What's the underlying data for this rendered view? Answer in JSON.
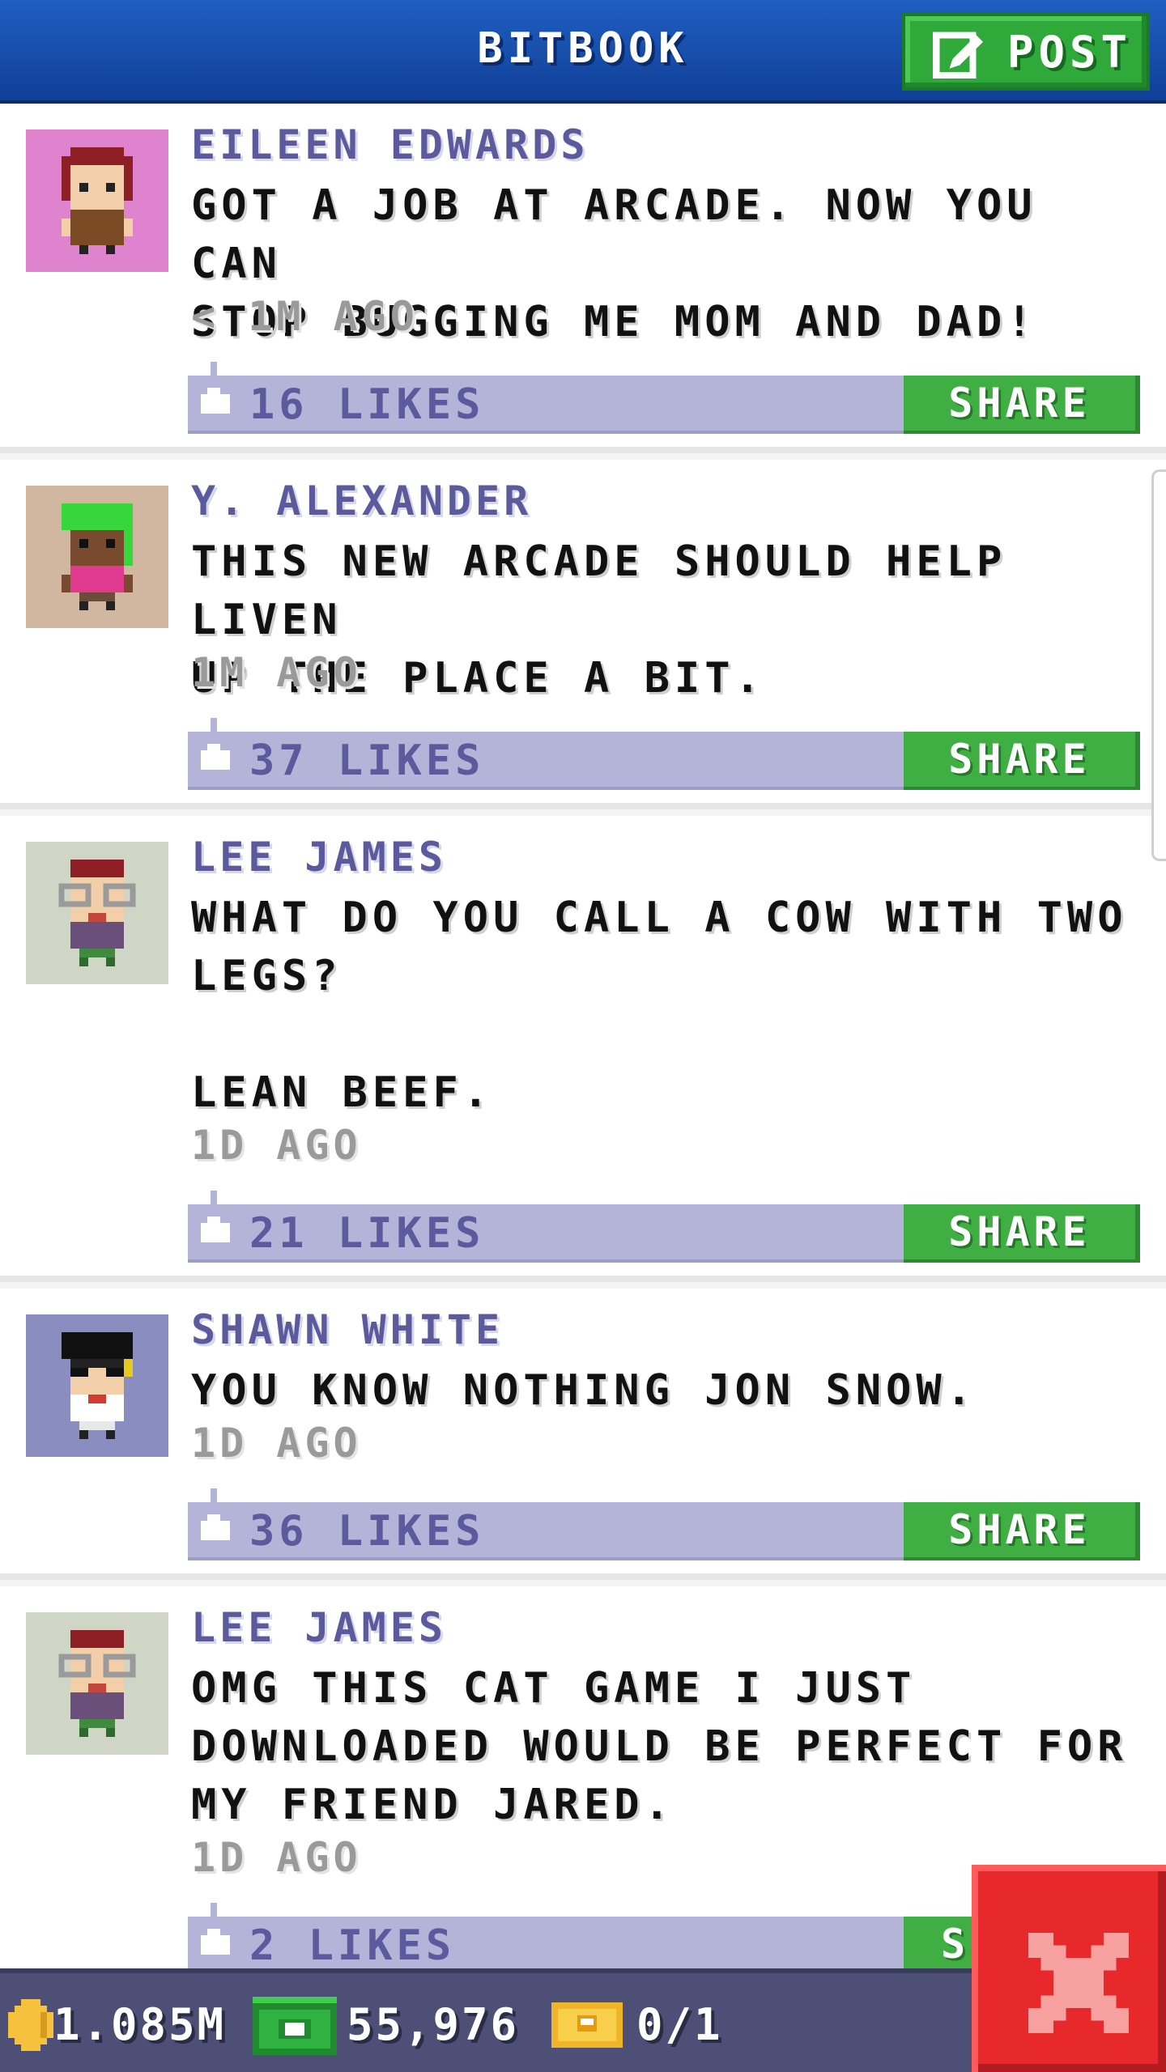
{
  "header": {
    "title": "BITBOOK",
    "post_label": "POST"
  },
  "posts": [
    {
      "author": "EILEEN EDWARDS",
      "message": "GOT A JOB AT ARCADE. NOW YOU CAN\nSTOP BUGGING ME MOM AND DAD!",
      "time": "< 1M AGO",
      "likes": "16 LIKES",
      "share": "SHARE",
      "avatar_bg": "#df83cf"
    },
    {
      "author": "Y. ALEXANDER",
      "message": "THIS NEW ARCADE SHOULD HELP LIVEN\nUP THE PLACE A BIT.",
      "time": "1M AGO",
      "likes": "37 LIKES",
      "share": "SHARE",
      "avatar_bg": "#d1b6a0"
    },
    {
      "author": "LEE JAMES",
      "message": "WHAT DO YOU CALL A COW WITH TWO\nLEGS?\n\nLEAN BEEF.",
      "time": "1D AGO",
      "likes": "21 LIKES",
      "share": "SHARE",
      "avatar_bg": "#cfd6c6"
    },
    {
      "author": "SHAWN WHITE",
      "message": "YOU KNOW NOTHING JON SNOW.",
      "time": "1D AGO",
      "likes": "36 LIKES",
      "share": "SHARE",
      "avatar_bg": "#8a8dc0"
    },
    {
      "author": "LEE JAMES",
      "message": "OMG THIS CAT GAME I JUST\nDOWNLOADED WOULD BE PERFECT FOR\nMY FRIEND JARED.",
      "time": "1D AGO",
      "likes": "2 LIKES",
      "share": "S",
      "avatar_bg": "#cfd6c6"
    }
  ],
  "status_bar": {
    "coins": "1.085M",
    "cash": "55,976",
    "tickets": "0/1"
  },
  "icons": {
    "post": "edit-icon",
    "like": "thumbs-up-icon",
    "coin": "coin-icon",
    "cash": "cash-icon",
    "ticket": "ticket-icon",
    "close": "close-icon"
  },
  "colors": {
    "header": "#1a55b5",
    "accent_green": "#3fae43",
    "likes_bar": "#b3b4d8",
    "author_text": "#5b5a9c",
    "close_red": "#e8292c"
  }
}
